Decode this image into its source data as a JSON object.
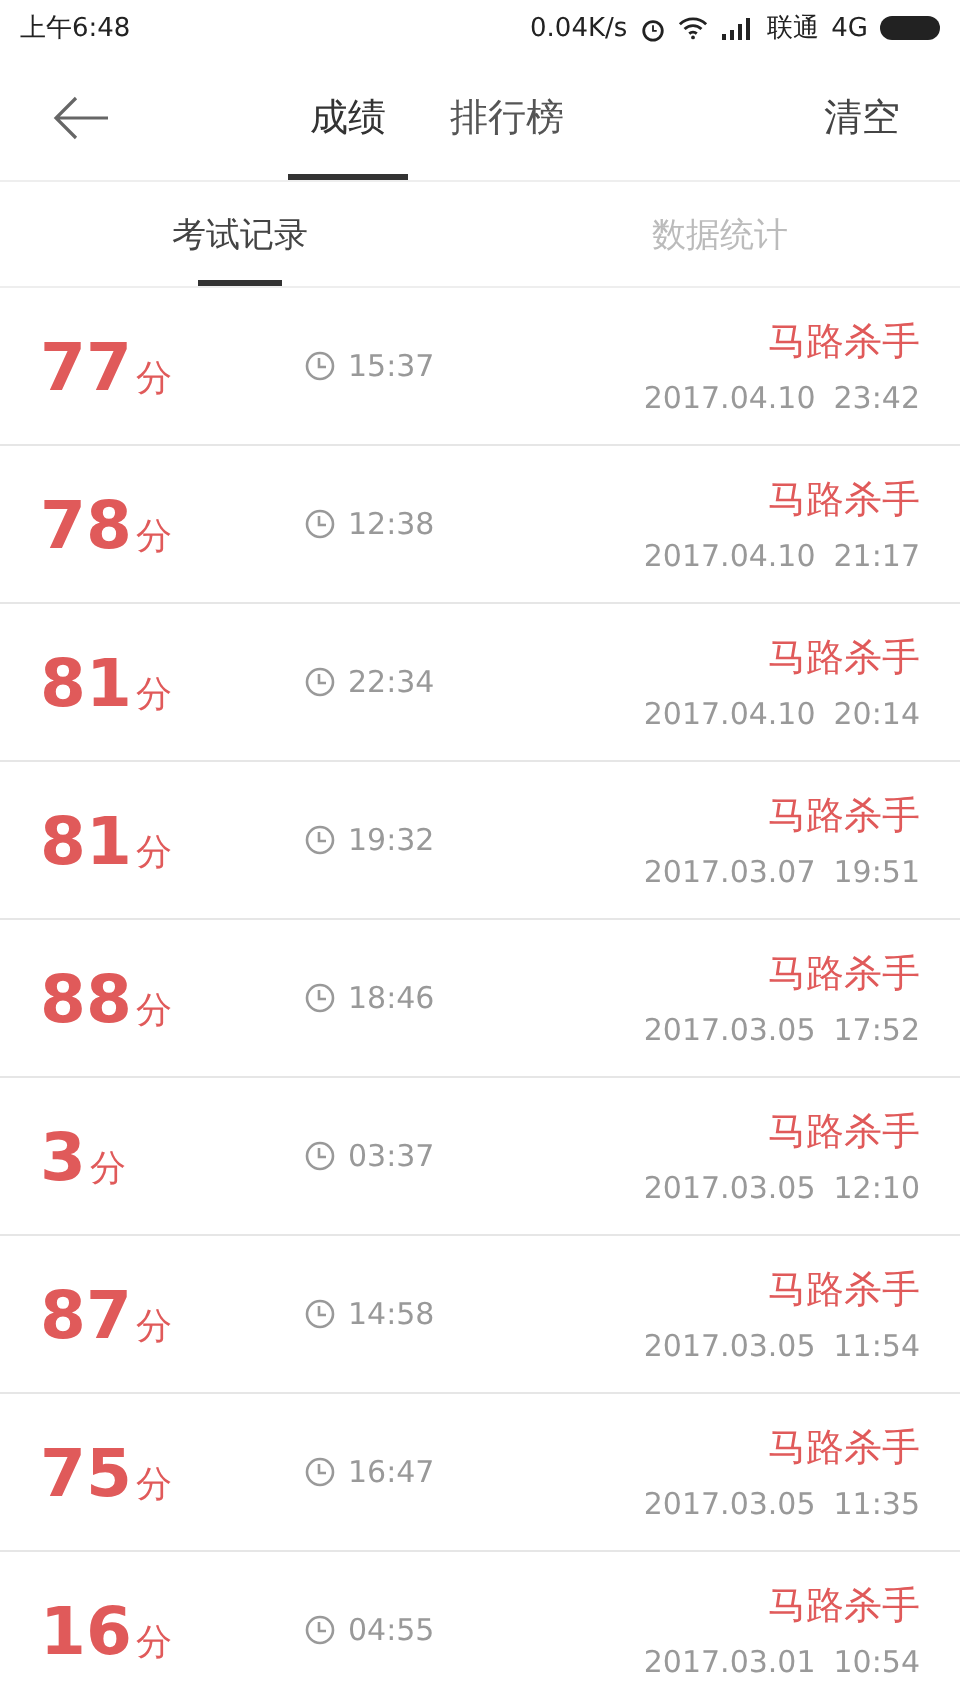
{
  "status_bar": {
    "time": "上午6:48",
    "speed": "0.04K/s",
    "carrier": "联通",
    "network": "4G"
  },
  "header": {
    "tabs": [
      {
        "label": "成绩",
        "selected": true
      },
      {
        "label": "排行榜",
        "selected": false
      }
    ],
    "action": "清空"
  },
  "subtabs": [
    {
      "label": "考试记录",
      "selected": true
    },
    {
      "label": "数据统计",
      "selected": false
    }
  ],
  "records": [
    {
      "score": "77",
      "unit": "分",
      "duration": "15:37",
      "title": "马路杀手",
      "date": "2017.04.10",
      "time": "23:42"
    },
    {
      "score": "78",
      "unit": "分",
      "duration": "12:38",
      "title": "马路杀手",
      "date": "2017.04.10",
      "time": "21:17"
    },
    {
      "score": "81",
      "unit": "分",
      "duration": "22:34",
      "title": "马路杀手",
      "date": "2017.04.10",
      "time": "20:14"
    },
    {
      "score": "81",
      "unit": "分",
      "duration": "19:32",
      "title": "马路杀手",
      "date": "2017.03.07",
      "time": "19:51"
    },
    {
      "score": "88",
      "unit": "分",
      "duration": "18:46",
      "title": "马路杀手",
      "date": "2017.03.05",
      "time": "17:52"
    },
    {
      "score": "3",
      "unit": "分",
      "duration": "03:37",
      "title": "马路杀手",
      "date": "2017.03.05",
      "time": "12:10"
    },
    {
      "score": "87",
      "unit": "分",
      "duration": "14:58",
      "title": "马路杀手",
      "date": "2017.03.05",
      "time": "11:54"
    },
    {
      "score": "75",
      "unit": "分",
      "duration": "16:47",
      "title": "马路杀手",
      "date": "2017.03.05",
      "time": "11:35"
    },
    {
      "score": "16",
      "unit": "分",
      "duration": "04:55",
      "title": "马路杀手",
      "date": "2017.03.01",
      "time": "10:54"
    }
  ]
}
